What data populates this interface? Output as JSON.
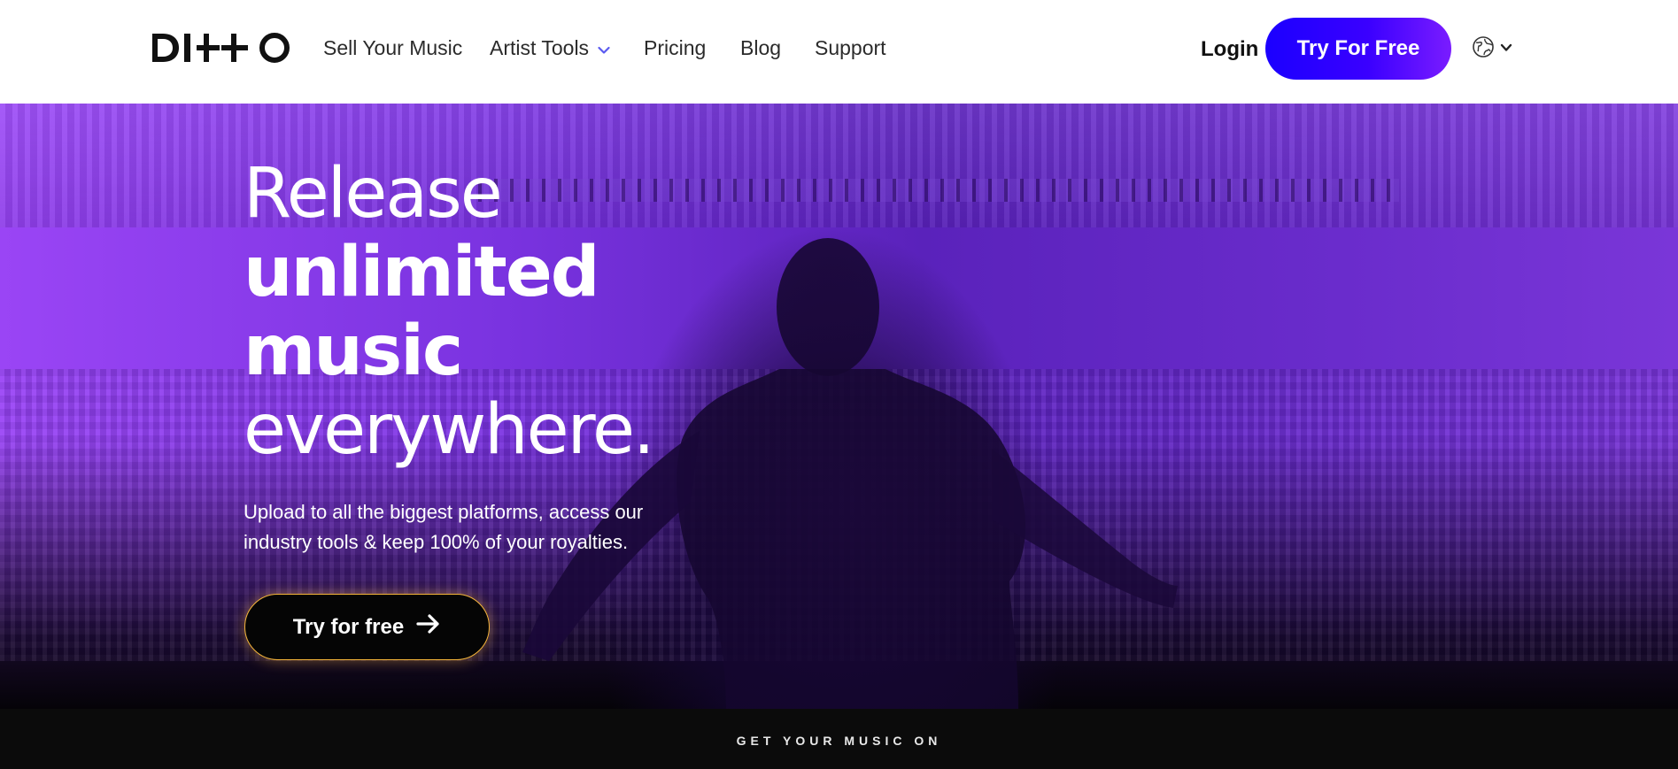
{
  "brand": {
    "logo_text": "DITTO"
  },
  "nav": {
    "items": [
      {
        "label": "Sell Your Music"
      },
      {
        "label": "Artist Tools"
      },
      {
        "label": "Pricing"
      },
      {
        "label": "Blog"
      },
      {
        "label": "Support"
      }
    ],
    "login_label": "Login",
    "cta_label": "Try For Free",
    "language_icon": "globe-icon"
  },
  "hero": {
    "headline_lines": [
      "Release",
      "unlimited",
      "music",
      "everywhere."
    ],
    "subtext_line1": "Upload to all the biggest platforms, access our",
    "subtext_line2": "industry tools & keep 100% of your royalties.",
    "cta_label": "Try for free"
  },
  "platforms": {
    "label": "GET YOUR MUSIC ON"
  },
  "colors": {
    "cta_gradient_start": "#1b00ff",
    "cta_gradient_end": "#7a1cff",
    "hero_purple": "#7a33e0",
    "hero_cta_border": "#f5b53a"
  }
}
